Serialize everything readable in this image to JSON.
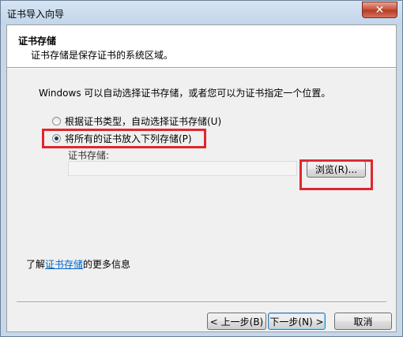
{
  "window": {
    "title": "证书导入向导",
    "close_symbol": "✕"
  },
  "header": {
    "title": "证书存储",
    "description": "证书存储是保存证书的系统区域。"
  },
  "intro_text": "Windows 可以自动选择证书存储，或者您可以为证书指定一个位置。",
  "options": {
    "auto": {
      "label": "根据证书类型，自动选择证书存储(U)",
      "checked": false
    },
    "manual": {
      "label": "将所有的证书放入下列存储(P)",
      "checked": true
    }
  },
  "store": {
    "label": "证书存储:",
    "value": "",
    "browse_label": "浏览(R)..."
  },
  "more_info": {
    "prefix": "了解",
    "link": "证书存储",
    "suffix": "的更多信息"
  },
  "buttons": {
    "back": "< 上一步(B)",
    "next": "下一步(N) >",
    "cancel": "取消"
  },
  "colors": {
    "highlight": "#e0262e",
    "link": "#0066cc",
    "close": "#c7503a"
  }
}
